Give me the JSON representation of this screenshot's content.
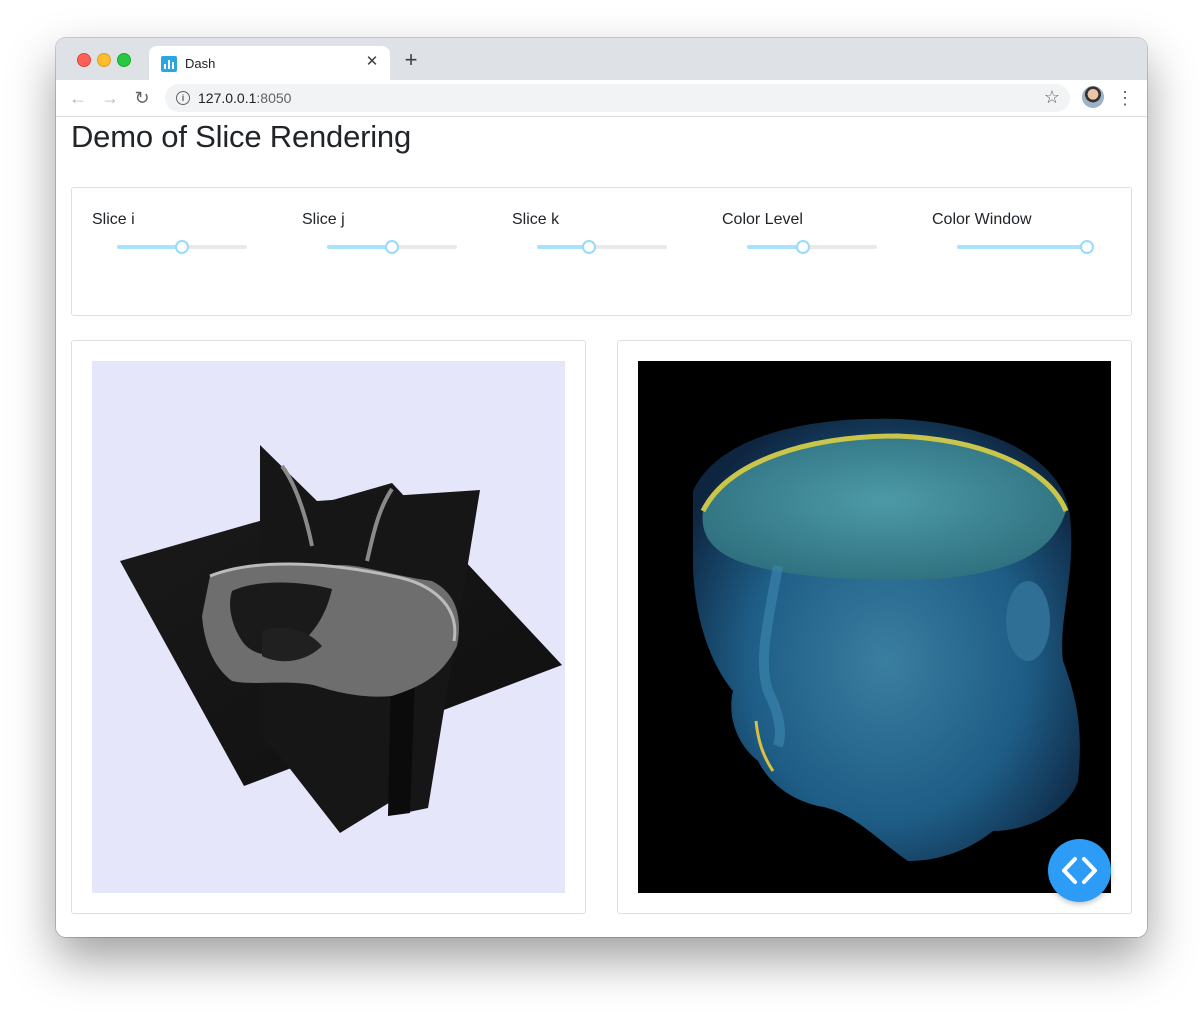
{
  "browser": {
    "tab_title": "Dash",
    "tab_close_glyph": "✕",
    "new_tab_glyph": "+",
    "url_host": "127.0.0.1",
    "url_port": ":8050",
    "back_glyph": "←",
    "forward_glyph": "→",
    "reload_glyph": "↻",
    "star_glyph": "☆",
    "menu_glyph": "⋮",
    "info_glyph": "i"
  },
  "page": {
    "title": "Demo of Slice Rendering"
  },
  "controls": [
    {
      "label": "Slice i",
      "value": 0.5
    },
    {
      "label": "Slice j",
      "value": 0.5
    },
    {
      "label": "Slice k",
      "value": 0.4
    },
    {
      "label": "Color Level",
      "value": 0.43
    },
    {
      "label": "Color Window",
      "value": 1.0
    }
  ],
  "views": {
    "slice_view_background": "#e6e6fa",
    "volume_view_background": "#000000"
  },
  "colors": {
    "slider_track": "#abe2fb",
    "slider_handle_border": "#96dbfa",
    "dev_button": "#2c9cf7"
  },
  "icons": {
    "tab_favicon": "dash-bar-chart-icon",
    "dev_tools": "code-brackets-icon"
  }
}
